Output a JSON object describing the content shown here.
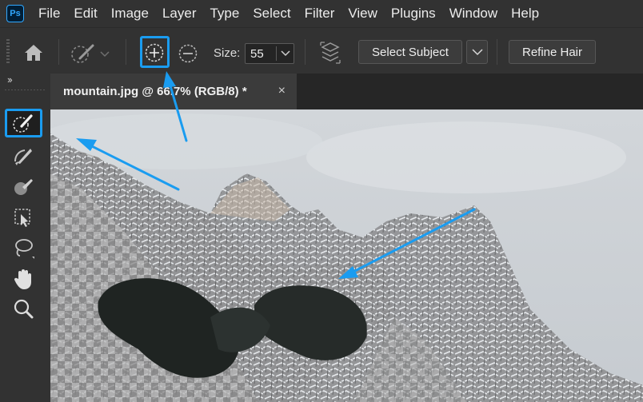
{
  "app": {
    "logo_text": "Ps"
  },
  "menu": [
    "File",
    "Edit",
    "Image",
    "Layer",
    "Type",
    "Select",
    "Filter",
    "View",
    "Plugins",
    "Window",
    "Help"
  ],
  "options_bar": {
    "size_label": "Size:",
    "size_value": "55",
    "select_subject_label": "Select Subject",
    "refine_hair_label": "Refine Hair"
  },
  "toolbar": {
    "collapse_glyph": "››",
    "tools": [
      "quick-selection",
      "object-brush",
      "color-brush",
      "object-selection",
      "lasso",
      "hand",
      "zoom"
    ],
    "active_tool": "quick-selection"
  },
  "document": {
    "tab_title": "mountain.jpg @ 66.7% (RGB/8) *",
    "close_glyph": "×"
  },
  "colors": {
    "highlight": "#1a9cf0",
    "ps_blue": "#31a8ff",
    "ui_dark": "#323232"
  }
}
